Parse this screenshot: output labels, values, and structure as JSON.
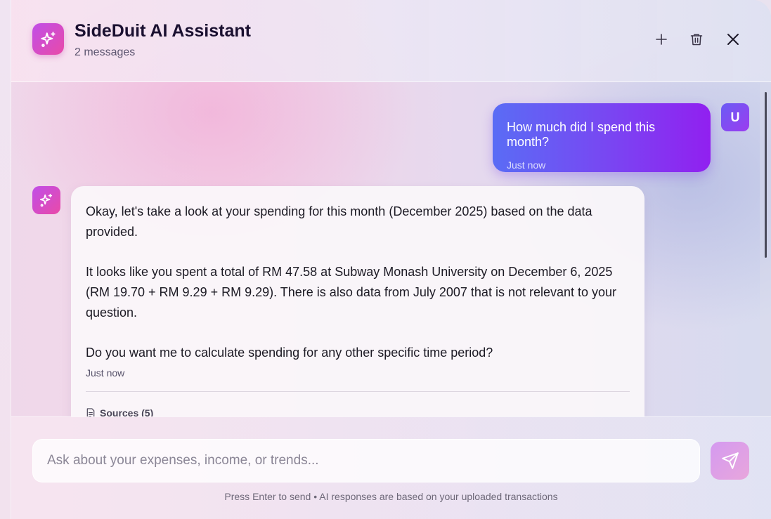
{
  "header": {
    "title": "SideDuit AI Assistant",
    "subtitle": "2 messages",
    "actions": [
      "plus-icon",
      "trash-icon",
      "close-icon"
    ]
  },
  "messages": {
    "user": {
      "avatar_letter": "U",
      "text": "How much did I spend this month?",
      "time": "Just now"
    },
    "assistant": {
      "paragraphs": [
        "Okay, let's take a look at your spending for this month (December 2025) based on the data provided.",
        "It looks like you spent a total of RM 47.58 at Subway Monash University on December 6, 2025 (RM 19.70 + RM 9.29 + RM 9.29). There is also data from July 2007 that is not relevant to your question.",
        "Do you want me to calculate spending for any other specific time period?"
      ],
      "time": "Just now",
      "sources_label": "Sources (5)"
    }
  },
  "composer": {
    "placeholder": "Ask about your expenses, income, or trends...",
    "hint": "Press Enter to send • AI responses are based on your uploaded transactions"
  },
  "colors": {
    "accent_start": "#5a6cf5",
    "accent_end": "#9120f0",
    "logo_start": "#c04ee8",
    "logo_end": "#e94aa8"
  }
}
